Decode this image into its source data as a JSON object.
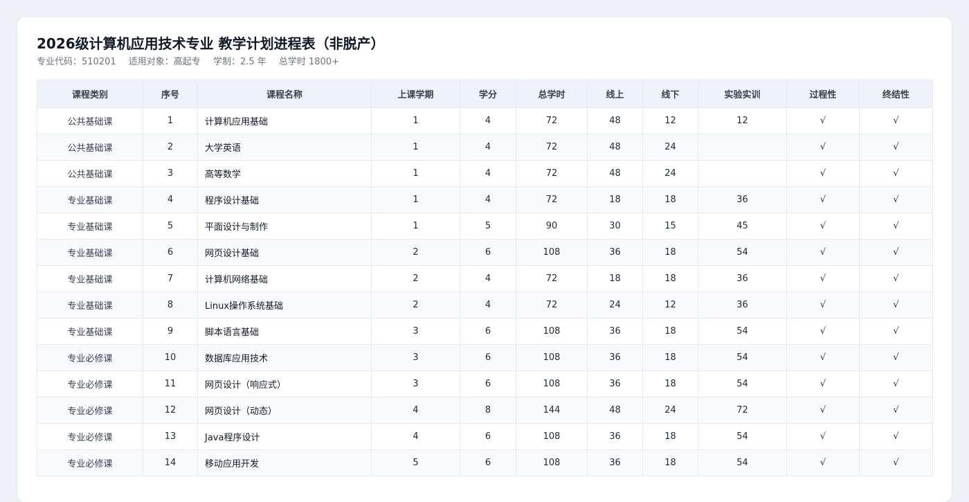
{
  "header": {
    "title": "2026级计算机应用技术专业 教学计划进程表（非脱产）",
    "meta": [
      "专业代码：510201",
      "适用对象：高起专",
      "学制：2.5 年",
      "总学时 1800+"
    ]
  },
  "table": {
    "columns": [
      "课程类别",
      "序号",
      "课程名称",
      "上课学期",
      "学分",
      "总学时",
      "线上",
      "线下",
      "实验实训",
      "过程性",
      "终结性"
    ],
    "rows": [
      [
        "公共基础课",
        "1",
        "计算机应用基础",
        "1",
        "4",
        "72",
        "48",
        "12",
        "12",
        "√",
        "√"
      ],
      [
        "公共基础课",
        "2",
        "大学英语",
        "1",
        "4",
        "72",
        "48",
        "24",
        "",
        "√",
        "√"
      ],
      [
        "公共基础课",
        "3",
        "高等数学",
        "1",
        "4",
        "72",
        "48",
        "24",
        "",
        "√",
        "√"
      ],
      [
        "专业基础课",
        "4",
        "程序设计基础",
        "1",
        "4",
        "72",
        "18",
        "18",
        "36",
        "√",
        "√"
      ],
      [
        "专业基础课",
        "5",
        "平面设计与制作",
        "1",
        "5",
        "90",
        "30",
        "15",
        "45",
        "√",
        "√"
      ],
      [
        "专业基础课",
        "6",
        "网页设计基础",
        "2",
        "6",
        "108",
        "36",
        "18",
        "54",
        "√",
        "√"
      ],
      [
        "专业基础课",
        "7",
        "计算机网络基础",
        "2",
        "4",
        "72",
        "18",
        "18",
        "36",
        "√",
        "√"
      ],
      [
        "专业基础课",
        "8",
        "Linux操作系统基础",
        "2",
        "4",
        "72",
        "24",
        "12",
        "36",
        "√",
        "√"
      ],
      [
        "专业基础课",
        "9",
        "脚本语言基础",
        "3",
        "6",
        "108",
        "36",
        "18",
        "54",
        "√",
        "√"
      ],
      [
        "专业必修课",
        "10",
        "数据库应用技术",
        "3",
        "6",
        "108",
        "36",
        "18",
        "54",
        "√",
        "√"
      ],
      [
        "专业必修课",
        "11",
        "网页设计（响应式）",
        "3",
        "6",
        "108",
        "36",
        "18",
        "54",
        "√",
        "√"
      ],
      [
        "专业必修课",
        "12",
        "网页设计（动态）",
        "4",
        "8",
        "144",
        "48",
        "24",
        "72",
        "√",
        "√"
      ],
      [
        "专业必修课",
        "13",
        "Java程序设计",
        "4",
        "6",
        "108",
        "36",
        "18",
        "54",
        "√",
        "√"
      ],
      [
        "专业必修课",
        "14",
        "移动应用开发",
        "5",
        "6",
        "108",
        "36",
        "18",
        "54",
        "√",
        "√"
      ]
    ]
  }
}
